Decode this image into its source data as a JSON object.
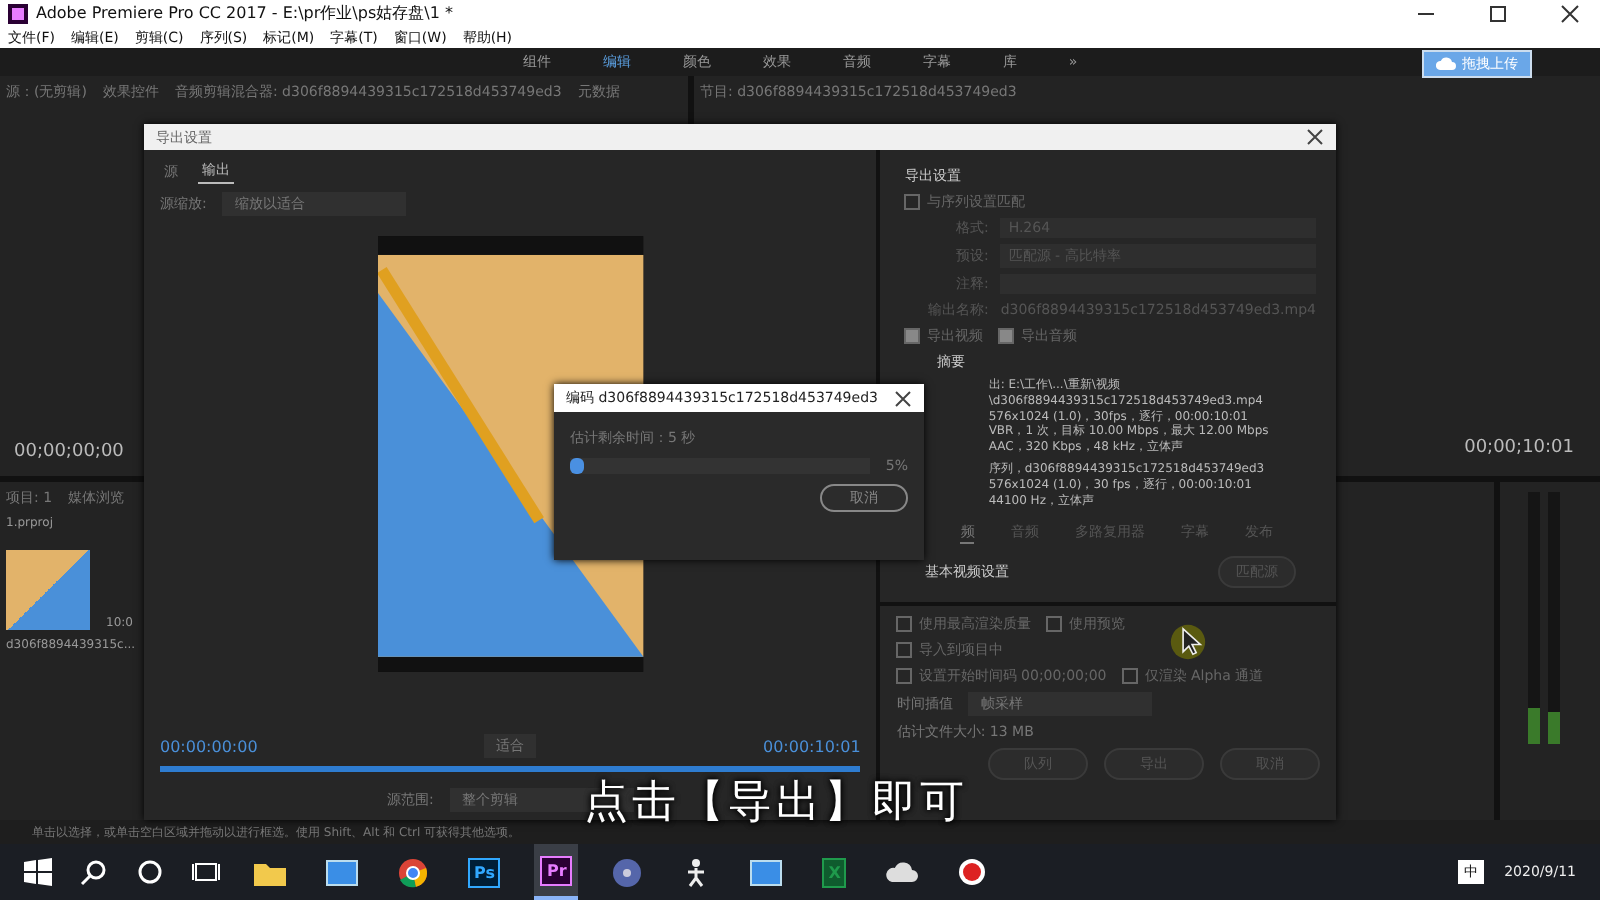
{
  "window": {
    "title": "Adobe Premiere Pro CC 2017 - E:\\pr作业\\ps姑存盘\\1 *"
  },
  "menu": [
    "文件(F)",
    "编辑(E)",
    "剪辑(C)",
    "序列(S)",
    "标记(M)",
    "字幕(T)",
    "窗口(W)",
    "帮助(H)"
  ],
  "workspaces": [
    {
      "label": "组件",
      "selected": false
    },
    {
      "label": "编辑",
      "selected": true
    },
    {
      "label": "颜色",
      "selected": false
    },
    {
      "label": "效果",
      "selected": false
    },
    {
      "label": "音频",
      "selected": false
    },
    {
      "label": "字幕",
      "selected": false
    },
    {
      "label": "库",
      "selected": false
    },
    {
      "label": "»",
      "selected": false
    }
  ],
  "upload_button": "拖拽上传",
  "panel_tabs": [
    "源：(无剪辑)",
    "效果控件",
    "音频剪辑混合器: d306f8894439315c172518d453749ed3",
    "元数据"
  ],
  "program_tab": "节目: d306f8894439315c172518d453749ed3",
  "source_timecode": "00;00;00;00",
  "program_timecode": "00;00;10:01",
  "project": {
    "tabs": [
      "项目: 1",
      "媒体浏览"
    ],
    "file": "1.prproj",
    "clip_name": "d306f8894439315c...",
    "clip_duration": "10:0"
  },
  "export_dialog": {
    "title": "导出设置",
    "tabs": [
      {
        "label": "源",
        "selected": false
      },
      {
        "label": "输出",
        "selected": true
      }
    ],
    "scale_label": "源缩放:",
    "scale_value": "缩放以适合",
    "start_timecode": "00:00:00:00",
    "end_timecode": "00:00:10:01",
    "fit_value": "适合",
    "range_label": "源范围:",
    "range_value": "整个剪辑",
    "settings_heading": "导出设置",
    "match_sequence": {
      "label": "与序列设置匹配",
      "checked": false
    },
    "fields": [
      {
        "label": "格式:",
        "value": "H.264"
      },
      {
        "label": "预设:",
        "value": "匹配源 - 高比特率"
      },
      {
        "label": "注释:"
      }
    ],
    "output_name": {
      "label": "输出名称:",
      "value": "d306f8894439315c172518d453749ed3.mp4"
    },
    "export_checks": [
      {
        "label": "导出视频",
        "checked": true
      },
      {
        "label": "导出音频",
        "checked": true
      }
    ],
    "summary_heading": "摘要",
    "summary_output": [
      "出: E:\\工作\\...\\重新\\视频\\d306f8894439315c172518d453749ed3.mp4",
      "576x1024 (1.0)，30fps，逐行，00:00:10:01",
      "VBR，1 次，目标 10.00 Mbps，最大 12.00 Mbps",
      "AAC，320 Kbps，48 kHz，立体声"
    ],
    "summary_source": [
      "序列，d306f8894439315c172518d453749ed3",
      "576x1024 (1.0)，30 fps，逐行，00:00:10:01",
      "44100 Hz，立体声"
    ],
    "tabs_right": [
      {
        "label": "频",
        "selected": true
      },
      {
        "label": "音频",
        "selected": false
      },
      {
        "label": "多路复用器",
        "selected": false
      },
      {
        "label": "字幕",
        "selected": false
      },
      {
        "label": "发布",
        "selected": false
      }
    ],
    "video_heading": "基本视频设置",
    "match_source_button": "匹配源",
    "options": [
      {
        "label": "使用最高渲染质量",
        "checked": false
      },
      {
        "label": "使用预览",
        "checked": false
      },
      {
        "label": "导入到项目中",
        "checked": false
      },
      {
        "label": "设置开始时间码 00;00;00;00",
        "checked": false
      },
      {
        "label": "仅渲染 Alpha 通道",
        "checked": false
      }
    ],
    "interp_label": "时间插值",
    "interp_value": "帧采样",
    "file_size": "估计文件大小: 13 MB",
    "buttons": [
      "队列",
      "导出",
      "取消"
    ]
  },
  "encode_dialog": {
    "title": "编码 d306f8894439315c172518d453749ed3",
    "remaining": "估计剩余时间：5 秒",
    "level": 0.05,
    "percent": "5%",
    "cancel": "取消"
  },
  "caption": "点击【导出】即可",
  "status_text": "单击以选择，或单击空白区域并拖动以进行框选。使用 Shift、Alt 和 Ctrl 可获得其他选项。",
  "taskbar": {
    "apps": [
      {
        "kind": "folder",
        "selected": false
      },
      {
        "kind": "window",
        "selected": false
      },
      {
        "kind": "browser",
        "selected": false
      },
      {
        "kind": "app",
        "label": "Ps",
        "selected": false
      },
      {
        "kind": "app",
        "label": "Pr",
        "selected": true
      },
      {
        "kind": "disc",
        "selected": false
      },
      {
        "kind": "figure",
        "selected": false
      },
      {
        "kind": "window",
        "selected": false
      },
      {
        "kind": "app",
        "label": "X",
        "selected": false
      },
      {
        "kind": "cloud",
        "selected": false
      },
      {
        "kind": "record",
        "selected": false
      }
    ],
    "ime": "中",
    "date": "2020/9/11"
  }
}
